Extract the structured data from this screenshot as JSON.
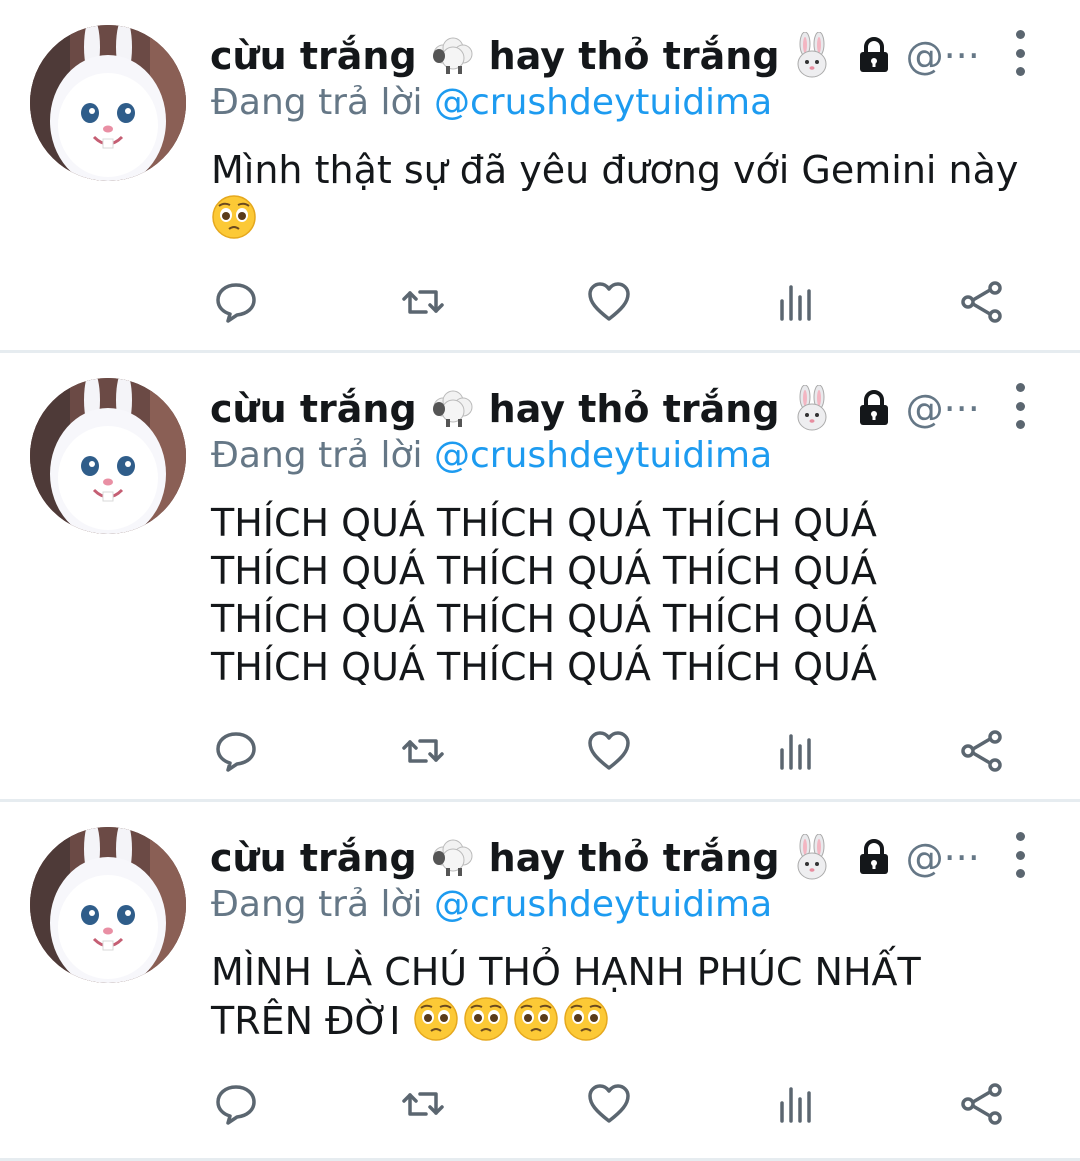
{
  "tweets": [
    {
      "display_name_part1": "cừu trắng",
      "display_name_part2": "hay thỏ trắng",
      "handle": "@···",
      "reply_prefix": "Đang trả lời",
      "reply_mention": "@crushdeytuidima",
      "content_lines": [
        "Mình thật sự đã yêu đương với Gemini này"
      ],
      "content_emoji": "pleading-face"
    },
    {
      "display_name_part1": "cừu trắng",
      "display_name_part2": "hay thỏ trắng",
      "handle": "@···",
      "reply_prefix": "Đang trả lời",
      "reply_mention": "@crushdeytuidima",
      "content_lines": [
        "THÍCH QUÁ THÍCH QUÁ THÍCH QUÁ",
        "THÍCH QUÁ THÍCH QUÁ THÍCH QUÁ",
        "THÍCH QUÁ THÍCH QUÁ THÍCH QUÁ",
        "THÍCH QUÁ THÍCH QUÁ THÍCH QUÁ"
      ]
    },
    {
      "display_name_part1": "cừu trắng",
      "display_name_part2": "hay thỏ trắng",
      "handle": "@···",
      "reply_prefix": "Đang trả lời",
      "reply_mention": "@crushdeytuidima",
      "content_lines": [
        "MÌNH LÀ CHÚ THỎ HẠNH PHÚC NHẤT",
        "TRÊN ĐỜI"
      ],
      "content_emoji": "pleading-face x4"
    }
  ],
  "icons": {
    "name_emoji_1": "sheep-icon",
    "name_emoji_2": "rabbit-face-icon",
    "protected": "lock-icon",
    "more": "more-vertical-icon",
    "actions": [
      "reply-icon",
      "retweet-icon",
      "like-icon",
      "analytics-icon",
      "share-icon"
    ]
  },
  "colors": {
    "mention": "#1d9bf0",
    "secondary_text": "#657786",
    "icon": "#5b6670",
    "divider": "#e6ecf0"
  }
}
